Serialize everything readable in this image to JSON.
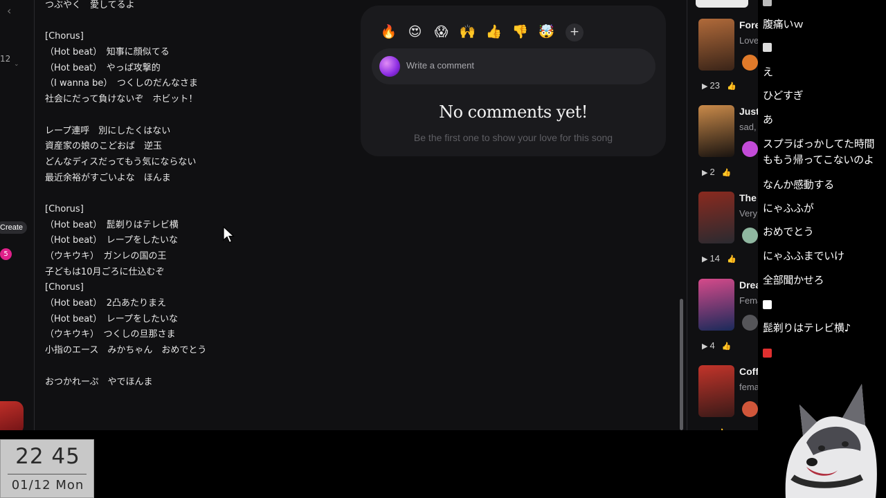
{
  "left_rail": {
    "back_icon": "chevron-left-icon",
    "number_label": "12",
    "create_label": "Create",
    "badge_count": "5"
  },
  "lyrics": [
    "つぶやく　愛してるよ",
    "",
    "[Chorus]",
    "（Hot beat）　知事に顔似てる",
    "（Hot beat）　やっぱ攻撃的",
    "（I wanna be）　つくしのだんなさま",
    "社会にだって負けないぞ　ホビット！",
    "",
    "レープ連呼　別にしたくはない",
    "資産家の娘のこどおば　逆玉",
    "どんなディスだってもう気にならない",
    "最近余裕がすごいよな　ほんま",
    "",
    "[Chorus]",
    "（Hot beat）　髭剃りはテレビ横",
    "（Hot beat）　レープをしたいな",
    "（ウキウキ）　ガンレの国の王",
    "子どもは10月ごろに仕込むぞ",
    "[Chorus]",
    "（Hot beat）　2凸あたりまえ",
    "（Hot beat）　レープをしたいな",
    "（ウキウキ）　つくしの旦那さま",
    "小指のエース　みかちゃん　おめでとう",
    "",
    "おつかれーぷ　やでほんま"
  ],
  "comments": {
    "reactions": [
      {
        "icon": "fire-icon",
        "glyph": "🔥"
      },
      {
        "icon": "heart-eyes-icon",
        "glyph": "😍"
      },
      {
        "icon": "screaming-face-icon",
        "glyph": "😱"
      },
      {
        "icon": "raised-hands-icon",
        "glyph": "🙌"
      },
      {
        "icon": "thumbs-up-icon",
        "glyph": "👍"
      },
      {
        "icon": "thumbs-down-icon",
        "glyph": "👎"
      },
      {
        "icon": "exploding-head-icon",
        "glyph": "🤯"
      }
    ],
    "add_reaction": "+",
    "placeholder": "Write a comment",
    "empty_title": "No comments yet!",
    "empty_subtitle": "Be the first one to show your love for this song"
  },
  "songs": [
    {
      "title": "Fore",
      "subtitle": "Love",
      "plays": "23",
      "thumb_colors": [
        "#b06a3a",
        "#3a2418"
      ],
      "avatar_color": "#e07a2a"
    },
    {
      "title": "Just",
      "subtitle": "sad,",
      "plays": "2",
      "thumb_colors": [
        "#c98a4a",
        "#1a1410"
      ],
      "avatar_color": "#c34bd8"
    },
    {
      "title": "The",
      "subtitle": "Very",
      "plays": "14",
      "thumb_colors": [
        "#8a2a1f",
        "#2a2a30"
      ],
      "avatar_color": "#8fb7a0"
    },
    {
      "title": "Drea",
      "subtitle": "Fema",
      "plays": "4",
      "thumb_colors": [
        "#d54a8a",
        "#1a2a5a"
      ],
      "avatar_color": "#555559"
    },
    {
      "title": "Coff",
      "subtitle": "fema",
      "plays": "",
      "thumb_colors": [
        "#c2342a",
        "#3a1a18"
      ],
      "avatar_color": "#d0563a"
    }
  ],
  "chat": [
    "腹痛いｗ",
    "え",
    "ひどすぎ",
    "あ",
    "スプラばっかしてた時間",
    "ももう帰ってこないのよ",
    "なんか感動する",
    "にゃふふが",
    "おめでとう",
    "にゃふふまでいけ",
    "全部聞かせろ",
    "髭剃りはテレビ横♪"
  ],
  "clock": {
    "time": "22 45",
    "date": "01/12 Mon"
  },
  "colors": {
    "app_bg": "#101012",
    "card_bg": "#1a1a1d",
    "badge": "#e0208a",
    "clock_bg": "#c8c8c8"
  }
}
